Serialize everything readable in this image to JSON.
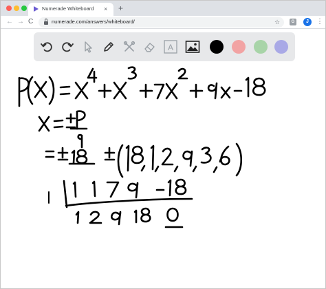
{
  "browser": {
    "tab_title": "Numerade Whiteboard",
    "tab_close": "×",
    "new_tab": "+",
    "url": "numerade.com/answers/whiteboard/",
    "nav_back": "←",
    "nav_forward": "→",
    "nav_reload": "C",
    "star": "☆",
    "ext_label": "G",
    "avatar_initial": "J",
    "menu": "⋮"
  },
  "toolbar": {
    "tools": [
      "undo-icon",
      "redo-icon",
      "select-icon",
      "pen-icon",
      "tools-icon",
      "eraser-icon",
      "text-icon",
      "image-icon"
    ],
    "text_tool_label": "A",
    "colors": [
      "#000000",
      "#f2a3a3",
      "#a8d4a8",
      "#a9a9e6"
    ]
  },
  "whiteboard": {
    "ink_color": "#000000",
    "handwriting": [
      "P(x) = x^4 + x^3 + 7x^2 + 9x − 18",
      "x = ± p/q",
      "= ± 18 ± (18, 1, 2, 9, 3, 6)",
      "1 | 1 1 7 9 −18",
      "1 2 9 18 0"
    ]
  }
}
